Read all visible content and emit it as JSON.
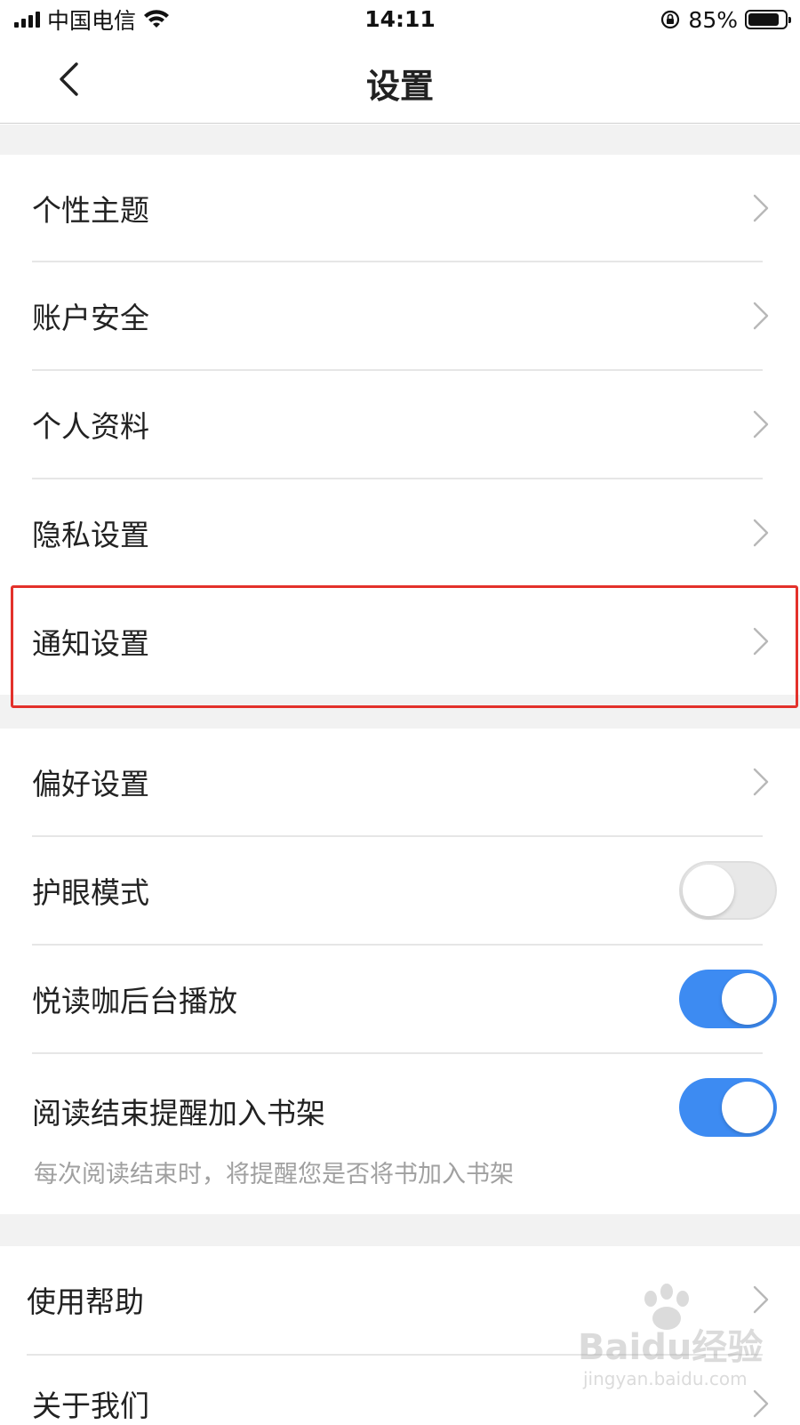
{
  "status_bar": {
    "carrier": "中国电信",
    "time": "14:11",
    "battery_percent": "85%",
    "battery_level": 0.85,
    "icons": [
      "signal-icon",
      "wifi-icon",
      "rotation-lock-icon",
      "battery-icon"
    ]
  },
  "nav": {
    "title": "设置",
    "back_icon": "chevron-left-icon"
  },
  "section1": {
    "items": [
      {
        "label": "个性主题"
      },
      {
        "label": "账户安全"
      },
      {
        "label": "个人资料"
      },
      {
        "label": "隐私设置"
      },
      {
        "label": "通知设置"
      }
    ]
  },
  "section2": {
    "preferences": {
      "label": "偏好设置"
    },
    "eye_protection": {
      "label": "护眼模式",
      "enabled": false
    },
    "background_play": {
      "label": "悦读咖后台播放",
      "enabled": true
    },
    "bookshelf_reminder": {
      "label": "阅读结束提醒加入书架",
      "enabled": true,
      "description": "每次阅读结束时，将提醒您是否将书加入书架"
    }
  },
  "section3": {
    "items": [
      {
        "label": "使用帮助"
      },
      {
        "label": "关于我们"
      }
    ]
  },
  "watermark": {
    "brand": "Baidu经验",
    "url": "jingyan.baidu.com"
  },
  "colors": {
    "toggle_on": "#3d8bf2",
    "highlight": "#e3312b",
    "section_gap": "#f2f2f2"
  }
}
